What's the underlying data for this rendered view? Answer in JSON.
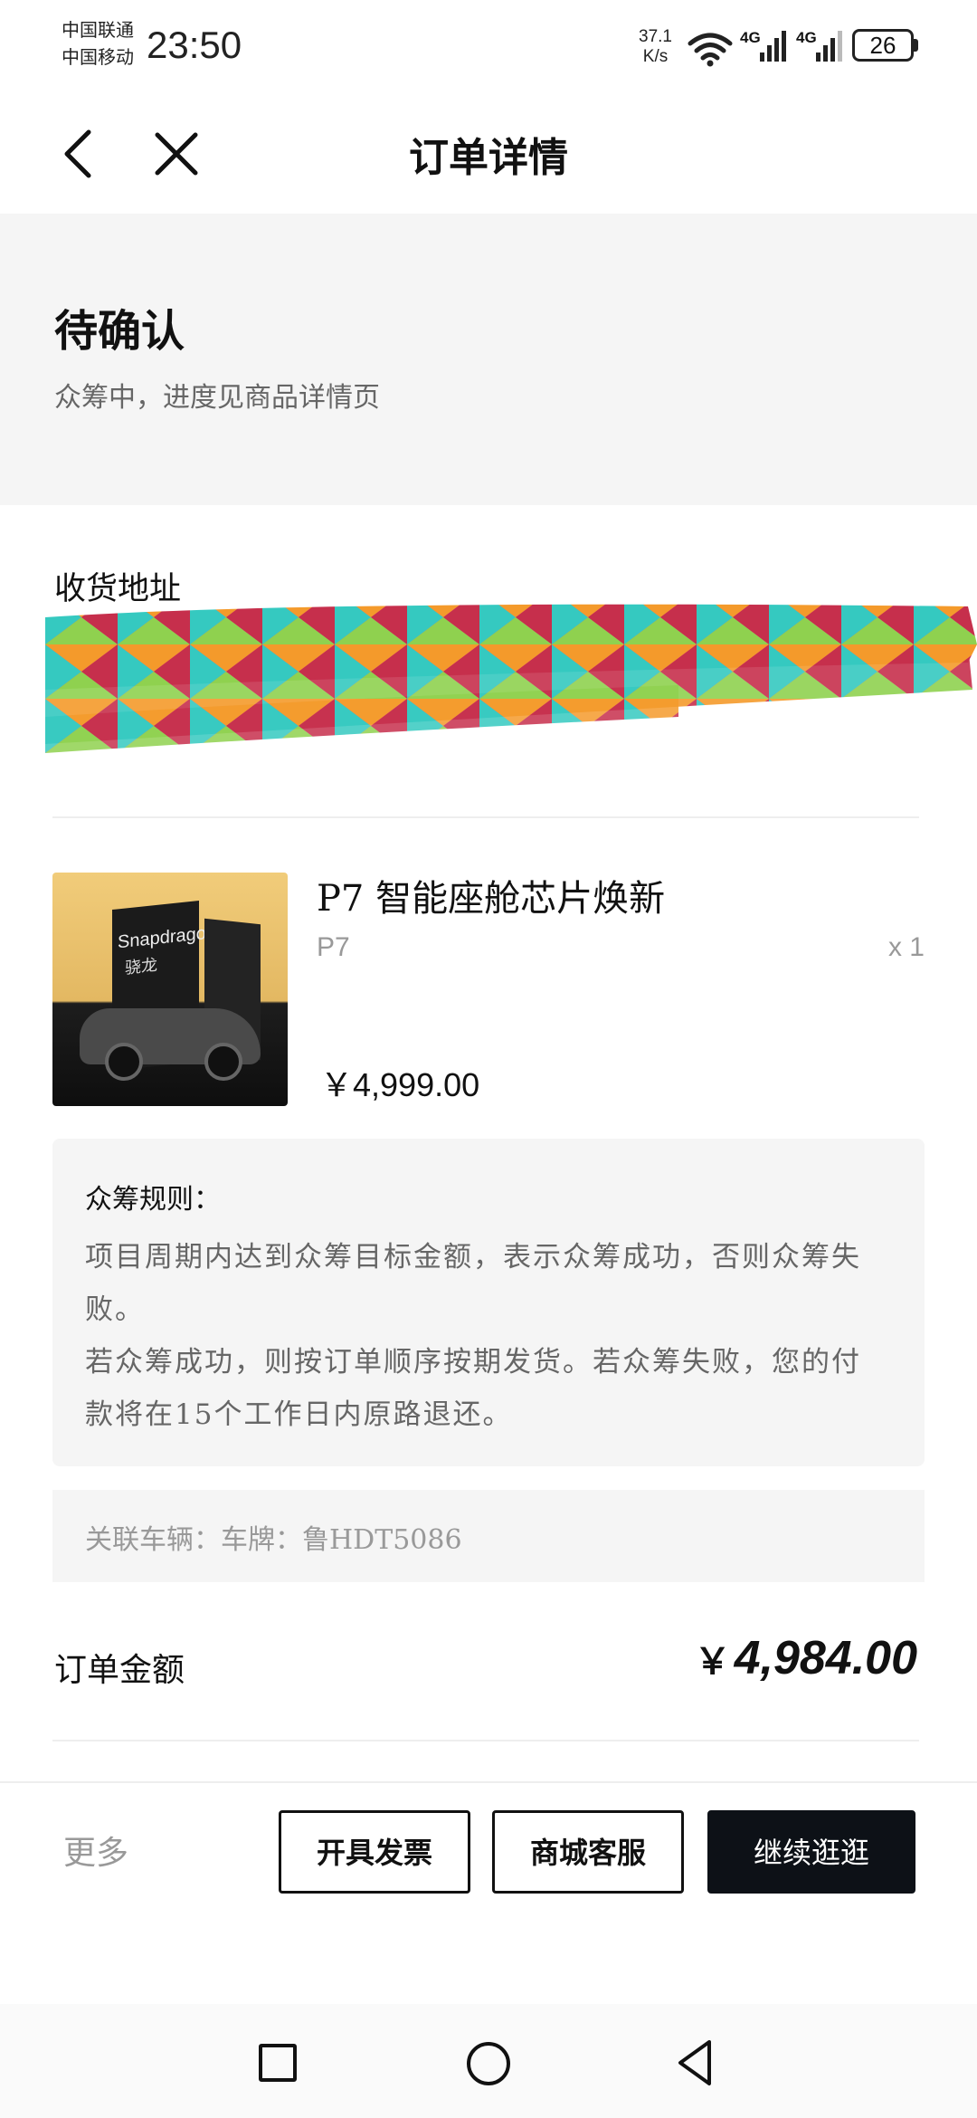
{
  "status_bar": {
    "carrier_1": "中国联通",
    "carrier_2": "中国移动",
    "time": "23:50",
    "net_speed_value": "37.1",
    "net_speed_unit": "K/s",
    "signal_1_label": "4G",
    "signal_2_label": "4G",
    "battery": "26"
  },
  "header": {
    "title": "订单详情",
    "back_icon": "chevron-left-icon",
    "close_icon": "close-icon"
  },
  "order_status": {
    "title": "待确认",
    "subtitle": "众筹中，进度见商品详情页"
  },
  "address": {
    "label": "收货地址"
  },
  "product": {
    "name": "P7 智能座舱芯片焕新",
    "variant": "P7",
    "quantity": "x 1",
    "price": "￥4,999.00",
    "image_brand_text": "Snapdragon",
    "image_brand_cn": "骁龙"
  },
  "rules": {
    "title": "众筹规则：",
    "body": "项目周期内达到众筹目标金额，表示众筹成功，否则众筹失败。\n若众筹成功，则按订单顺序按期发货。若众筹失败，您的付款将在15个工作日内原路退还。"
  },
  "vehicle": {
    "text": "关联车辆：车牌：鲁HDT5086"
  },
  "total": {
    "label": "订单金额",
    "currency": "￥",
    "amount": "4,984.00"
  },
  "actions": {
    "more": "更多",
    "invoice": "开具发票",
    "service": "商城客服",
    "browse": "继续逛逛"
  },
  "system_nav": {
    "recent_icon": "square-icon",
    "home_icon": "circle-icon",
    "back_icon": "triangle-back-icon"
  }
}
